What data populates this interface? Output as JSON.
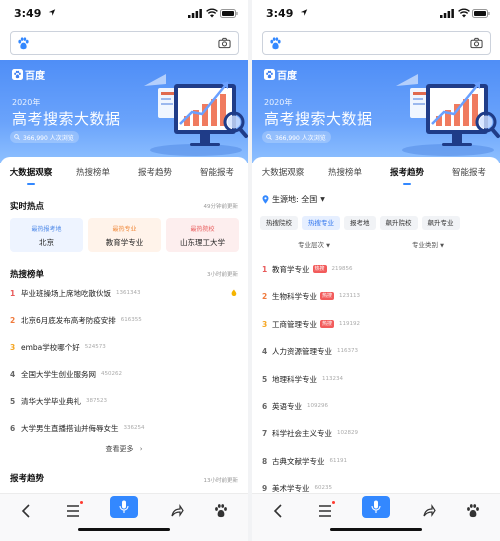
{
  "status": {
    "time": "3:49"
  },
  "brand": "百度",
  "banner": {
    "year": "2020年",
    "title": "高考搜索大数据",
    "visits": "366,990 人次浏览"
  },
  "tabs": [
    "大数据观察",
    "热搜榜单",
    "报考趋势",
    "智能报考"
  ],
  "left": {
    "active_tab": 0,
    "hot_title": "实时热点",
    "hot_note": "49分钟前更新",
    "hot_cards": [
      {
        "kind": "最热报考地",
        "value": "北京"
      },
      {
        "kind": "最热专业",
        "value": "教育学专业"
      },
      {
        "kind": "最热院校",
        "value": "山东理工大学"
      }
    ],
    "rank_title": "热搜榜单",
    "rank_note": "3小时前更新",
    "rank_items": [
      {
        "n": "1",
        "text": "毕业班操场上席地吃散伙饭",
        "count": "1361343"
      },
      {
        "n": "2",
        "text": "北京6月底发布高考防疫安排",
        "count": "616355"
      },
      {
        "n": "3",
        "text": "emba学校哪个好",
        "count": "524573"
      },
      {
        "n": "4",
        "text": "全国大学生创业服务网",
        "count": "450262"
      },
      {
        "n": "5",
        "text": "清华大学毕业典礼",
        "count": "387523"
      },
      {
        "n": "6",
        "text": "大学男生直播搭讪并侮辱女生",
        "count": "336254"
      }
    ],
    "more": "查看更多",
    "trend_title": "报考趋势",
    "trend_note": "13小时前更新"
  },
  "right": {
    "active_tab": 2,
    "source_label": "生源地: 全国",
    "chips": [
      "热搜院校",
      "热搜专业",
      "报考地",
      "飙升院校",
      "飙升专业"
    ],
    "active_chip": 1,
    "filter_a": "专业层次",
    "filter_b": "专业类别",
    "majors": [
      {
        "n": "1",
        "text": "教育学专业",
        "tag": "热搜",
        "count": "219856"
      },
      {
        "n": "2",
        "text": "生物科学专业",
        "tag": "热搜",
        "count": "123113"
      },
      {
        "n": "3",
        "text": "工商管理专业",
        "tag": "热搜",
        "count": "119192"
      },
      {
        "n": "4",
        "text": "人力资源管理专业",
        "tag": "",
        "count": "116373"
      },
      {
        "n": "5",
        "text": "地理科学专业",
        "tag": "",
        "count": "113234"
      },
      {
        "n": "6",
        "text": "英语专业",
        "tag": "",
        "count": "109296"
      },
      {
        "n": "7",
        "text": "科学社会主义专业",
        "tag": "",
        "count": "102829"
      },
      {
        "n": "8",
        "text": "古典文献学专业",
        "tag": "",
        "count": "61191"
      },
      {
        "n": "9",
        "text": "美术学专业",
        "tag": "",
        "count": "60235"
      }
    ]
  },
  "colors": {
    "accent": "#3388ff",
    "banner_top": "#4f8ef7",
    "hot_tag": "#f25b5b",
    "rank_top3": "#e85a5a"
  },
  "icons": {
    "search_bar_left": "paw-icon",
    "search_bar_right": "camera-icon",
    "nav": [
      "back-icon",
      "menu-icon",
      "mic-icon",
      "share-icon",
      "paw-icon"
    ]
  }
}
